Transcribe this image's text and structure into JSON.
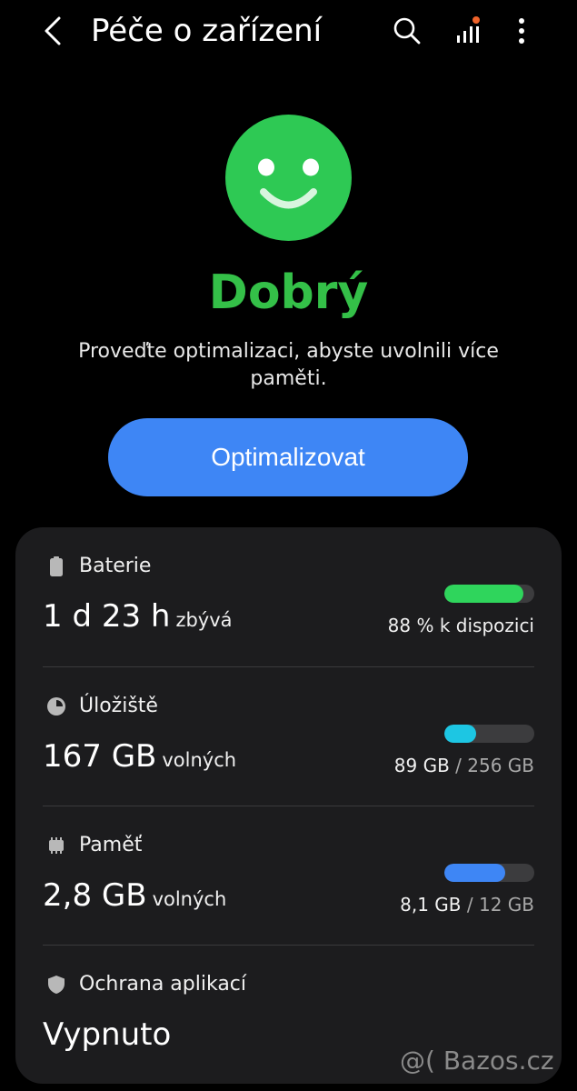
{
  "header": {
    "title": "Péče o zařízení"
  },
  "status": {
    "word": "Dobrý",
    "description": "Proveďte optimalizaci, abyste uvolnili více paměti.",
    "button_label": "Optimalizovat",
    "face_color": "#2ec954"
  },
  "battery": {
    "label": "Baterie",
    "value": "1 d 23 h",
    "unit": "zbývá",
    "level_percent": 88,
    "right_text": "88 % k dispozici",
    "bar_color": "#2fd55c"
  },
  "storage": {
    "label": "Úložiště",
    "value": "167 GB",
    "unit": "volných",
    "used": "89 GB",
    "separator": " / ",
    "total": "256 GB",
    "used_fraction": 0.35,
    "bar_color": "#1dc6e3"
  },
  "memory": {
    "label": "Paměť",
    "value": "2,8 GB",
    "unit": "volných",
    "used": "8,1 GB",
    "separator": " / ",
    "total": "12 GB",
    "used_fraction": 0.675,
    "bar_color": "#3e86f5"
  },
  "protection": {
    "label": "Ochrana aplikací",
    "value": "Vypnuto"
  },
  "watermark": {
    "text": "@( Bazos.cz"
  }
}
